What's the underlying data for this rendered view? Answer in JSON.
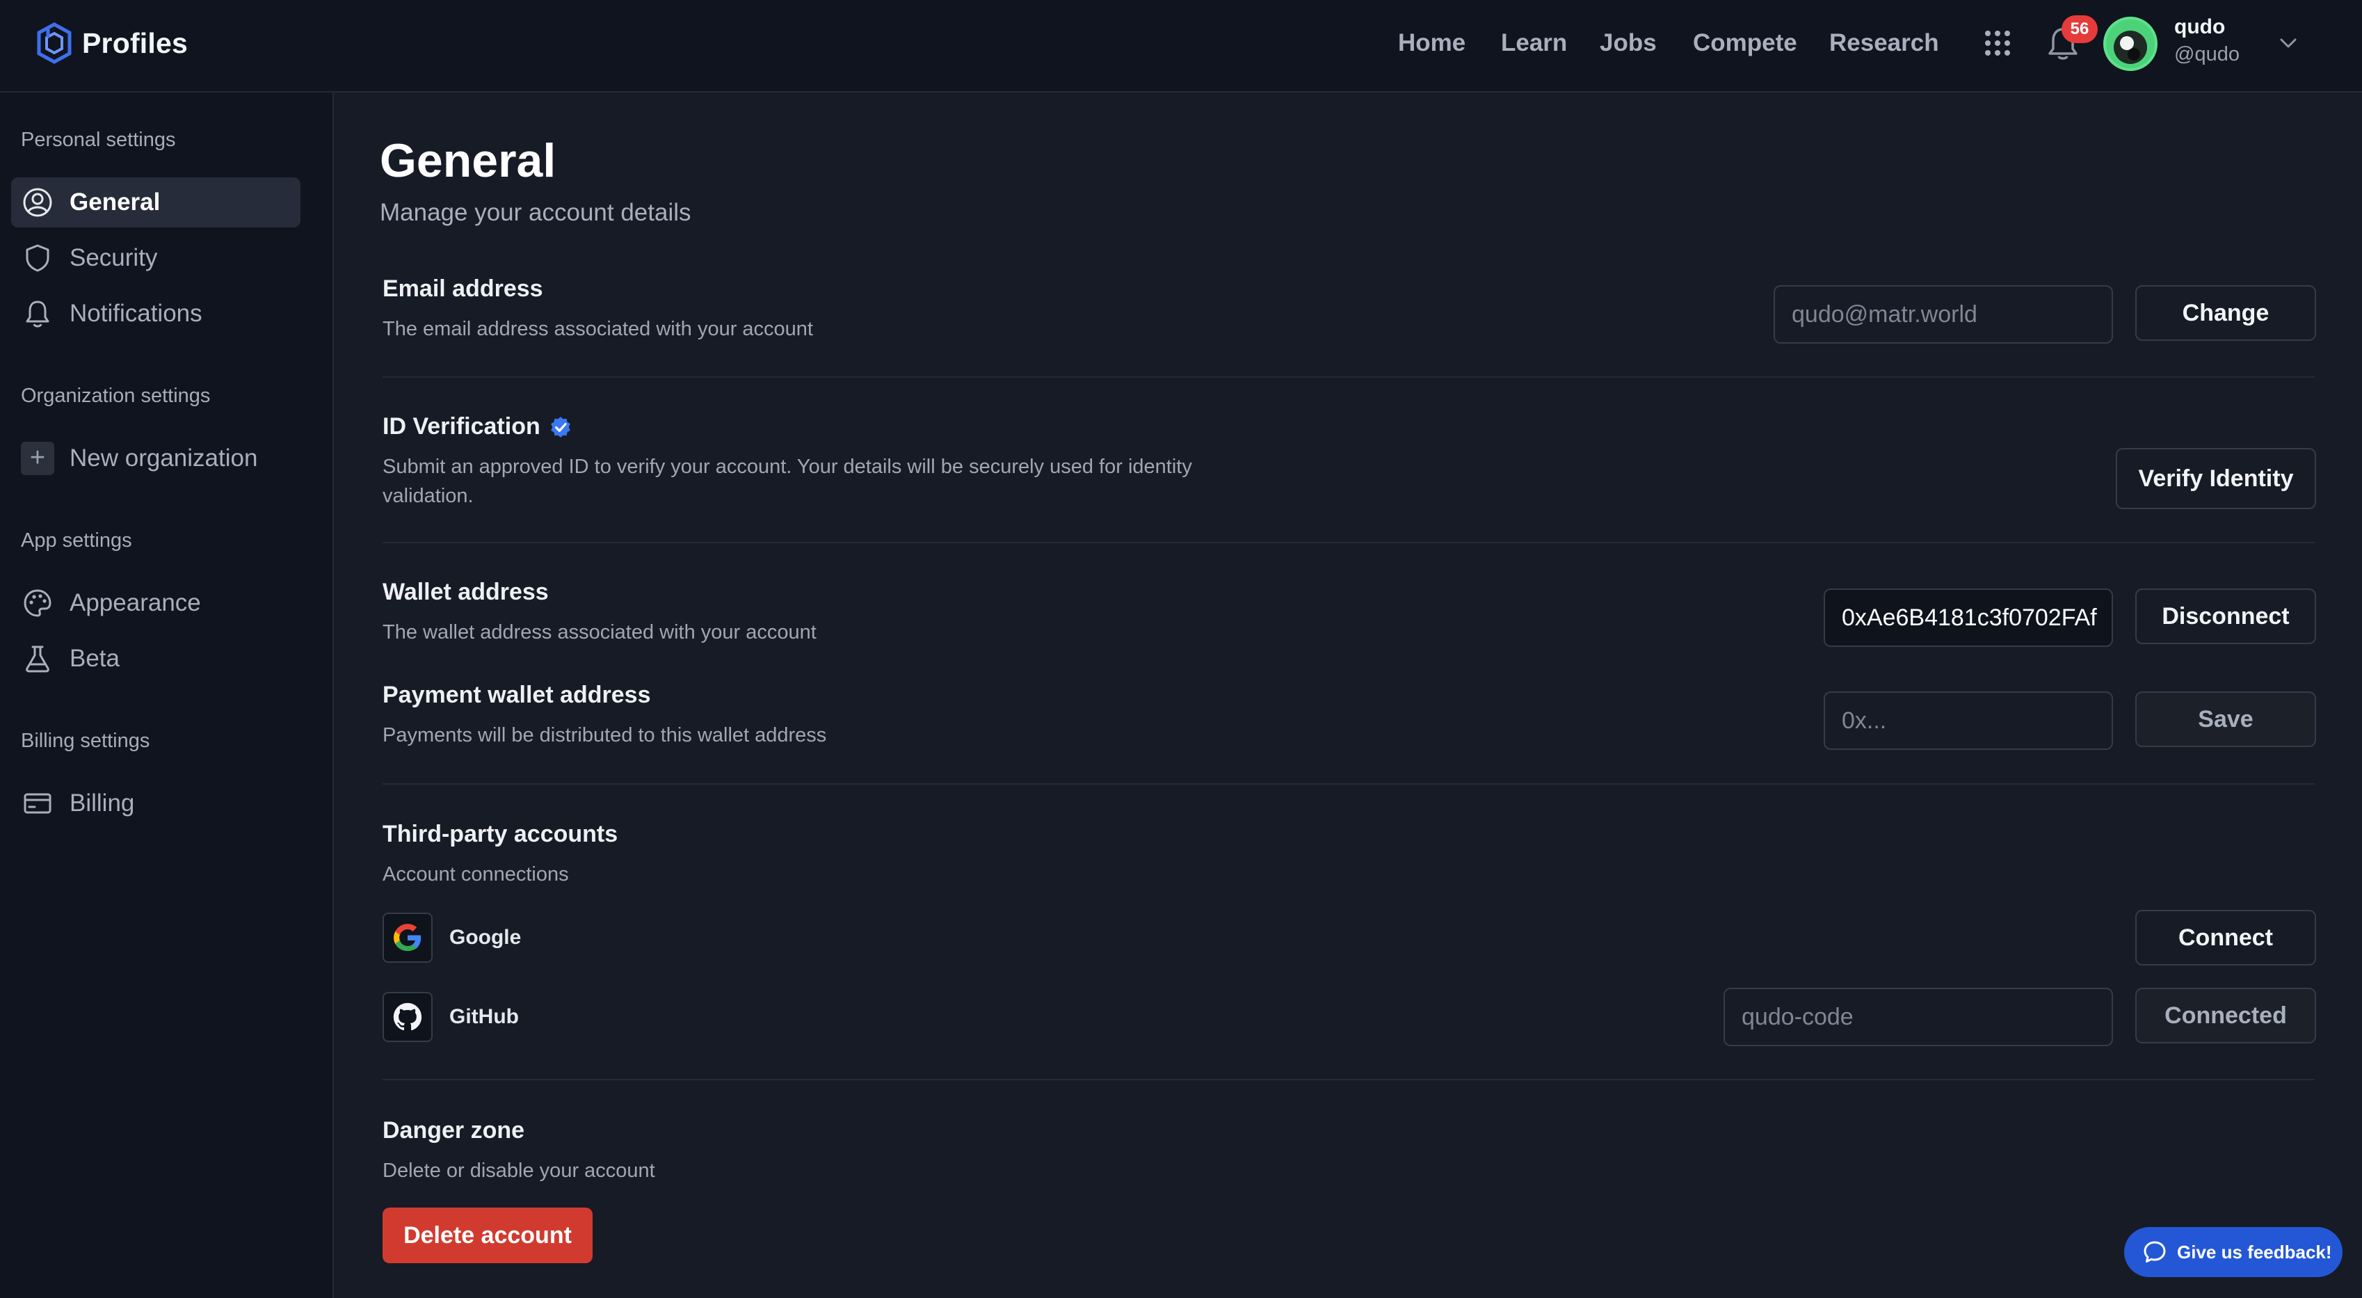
{
  "header": {
    "brand": "Profiles",
    "nav": [
      "Home",
      "Learn",
      "Jobs",
      "Compete",
      "Research"
    ],
    "notifications_count": "56",
    "user_name": "qudo",
    "user_handle": "@qudo"
  },
  "sidebar": {
    "personal_title": "Personal settings",
    "personal_items": [
      "General",
      "Security",
      "Notifications"
    ],
    "org_title": "Organization settings",
    "org_items": [
      "New organization"
    ],
    "app_title": "App settings",
    "app_items": [
      "Appearance",
      "Beta"
    ],
    "billing_title": "Billing settings",
    "billing_items": [
      "Billing"
    ],
    "active_item": "General"
  },
  "main": {
    "title": "General",
    "subtitle": "Manage your account details",
    "email": {
      "title": "Email address",
      "desc": "The email address associated with your account",
      "placeholder": "qudo@matr.world",
      "button": "Change"
    },
    "id_verification": {
      "title": "ID Verification",
      "desc": "Submit an approved ID to verify your account. Your details will be securely used for identity validation.",
      "button": "Verify Identity"
    },
    "wallet": {
      "title": "Wallet address",
      "desc": "The wallet address associated with your account",
      "value": "0xAe6B4181c3f0702FAf",
      "button": "Disconnect"
    },
    "payment_wallet": {
      "title": "Payment wallet address",
      "desc": "Payments will be distributed to this wallet address",
      "placeholder": "0x...",
      "button": "Save"
    },
    "third_party": {
      "title": "Third-party accounts",
      "desc": "Account connections",
      "google_name": "Google",
      "google_button": "Connect",
      "github_name": "GitHub",
      "github_placeholder": "qudo-code",
      "github_button": "Connected"
    },
    "danger": {
      "title": "Danger zone",
      "desc": "Delete or disable your account",
      "button": "Delete account"
    }
  },
  "feedback_label": "Give us feedback!",
  "colors": {
    "background": "#171b25",
    "header": "#0f141e",
    "accent_blue": "#2457d6",
    "danger": "#d13b2f",
    "badge": "#e53b3b",
    "avatar_ring": "#4cd37a"
  }
}
